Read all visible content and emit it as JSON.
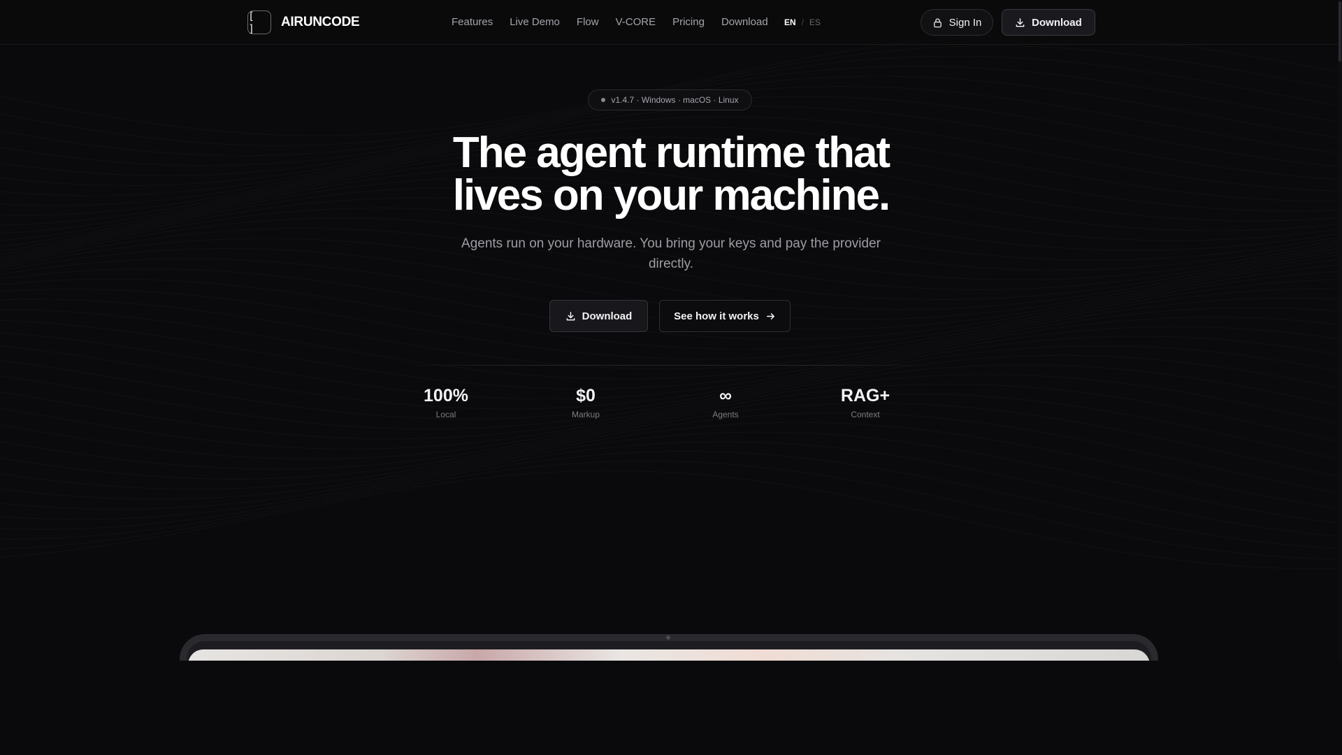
{
  "brand": {
    "name": "AIRUNCODE",
    "logo_icon": "bracket-frame-icon"
  },
  "nav": {
    "items": [
      "Features",
      "Live Demo",
      "Flow",
      "V-CORE",
      "Pricing",
      "Download"
    ]
  },
  "lang": {
    "active": "EN",
    "separator": "/",
    "inactive": "ES"
  },
  "header_actions": {
    "signin_label": "Sign In",
    "signin_icon": "lock-icon",
    "download_label": "Download",
    "download_icon": "download-icon"
  },
  "hero": {
    "badge": "v1.4.7 · Windows · macOS · Linux",
    "title_line1": "The agent runtime that",
    "title_line2": "lives on your machine.",
    "subtitle": "Agents run on your hardware. You bring your keys and pay the provider directly.",
    "primary_label": "Download",
    "secondary_label": "See how it works",
    "secondary_icon": "arrow-right-icon"
  },
  "stats": [
    {
      "value": "100%",
      "label": "Local"
    },
    {
      "value": "$0",
      "label": "Markup"
    },
    {
      "value": "∞",
      "label": "Agents"
    },
    {
      "value": "RAG+",
      "label": "Context"
    }
  ],
  "colors": {
    "background": "#0a0a0c",
    "text": "#ffffff",
    "muted": "#9d9da4",
    "border": "#2d2d33"
  }
}
